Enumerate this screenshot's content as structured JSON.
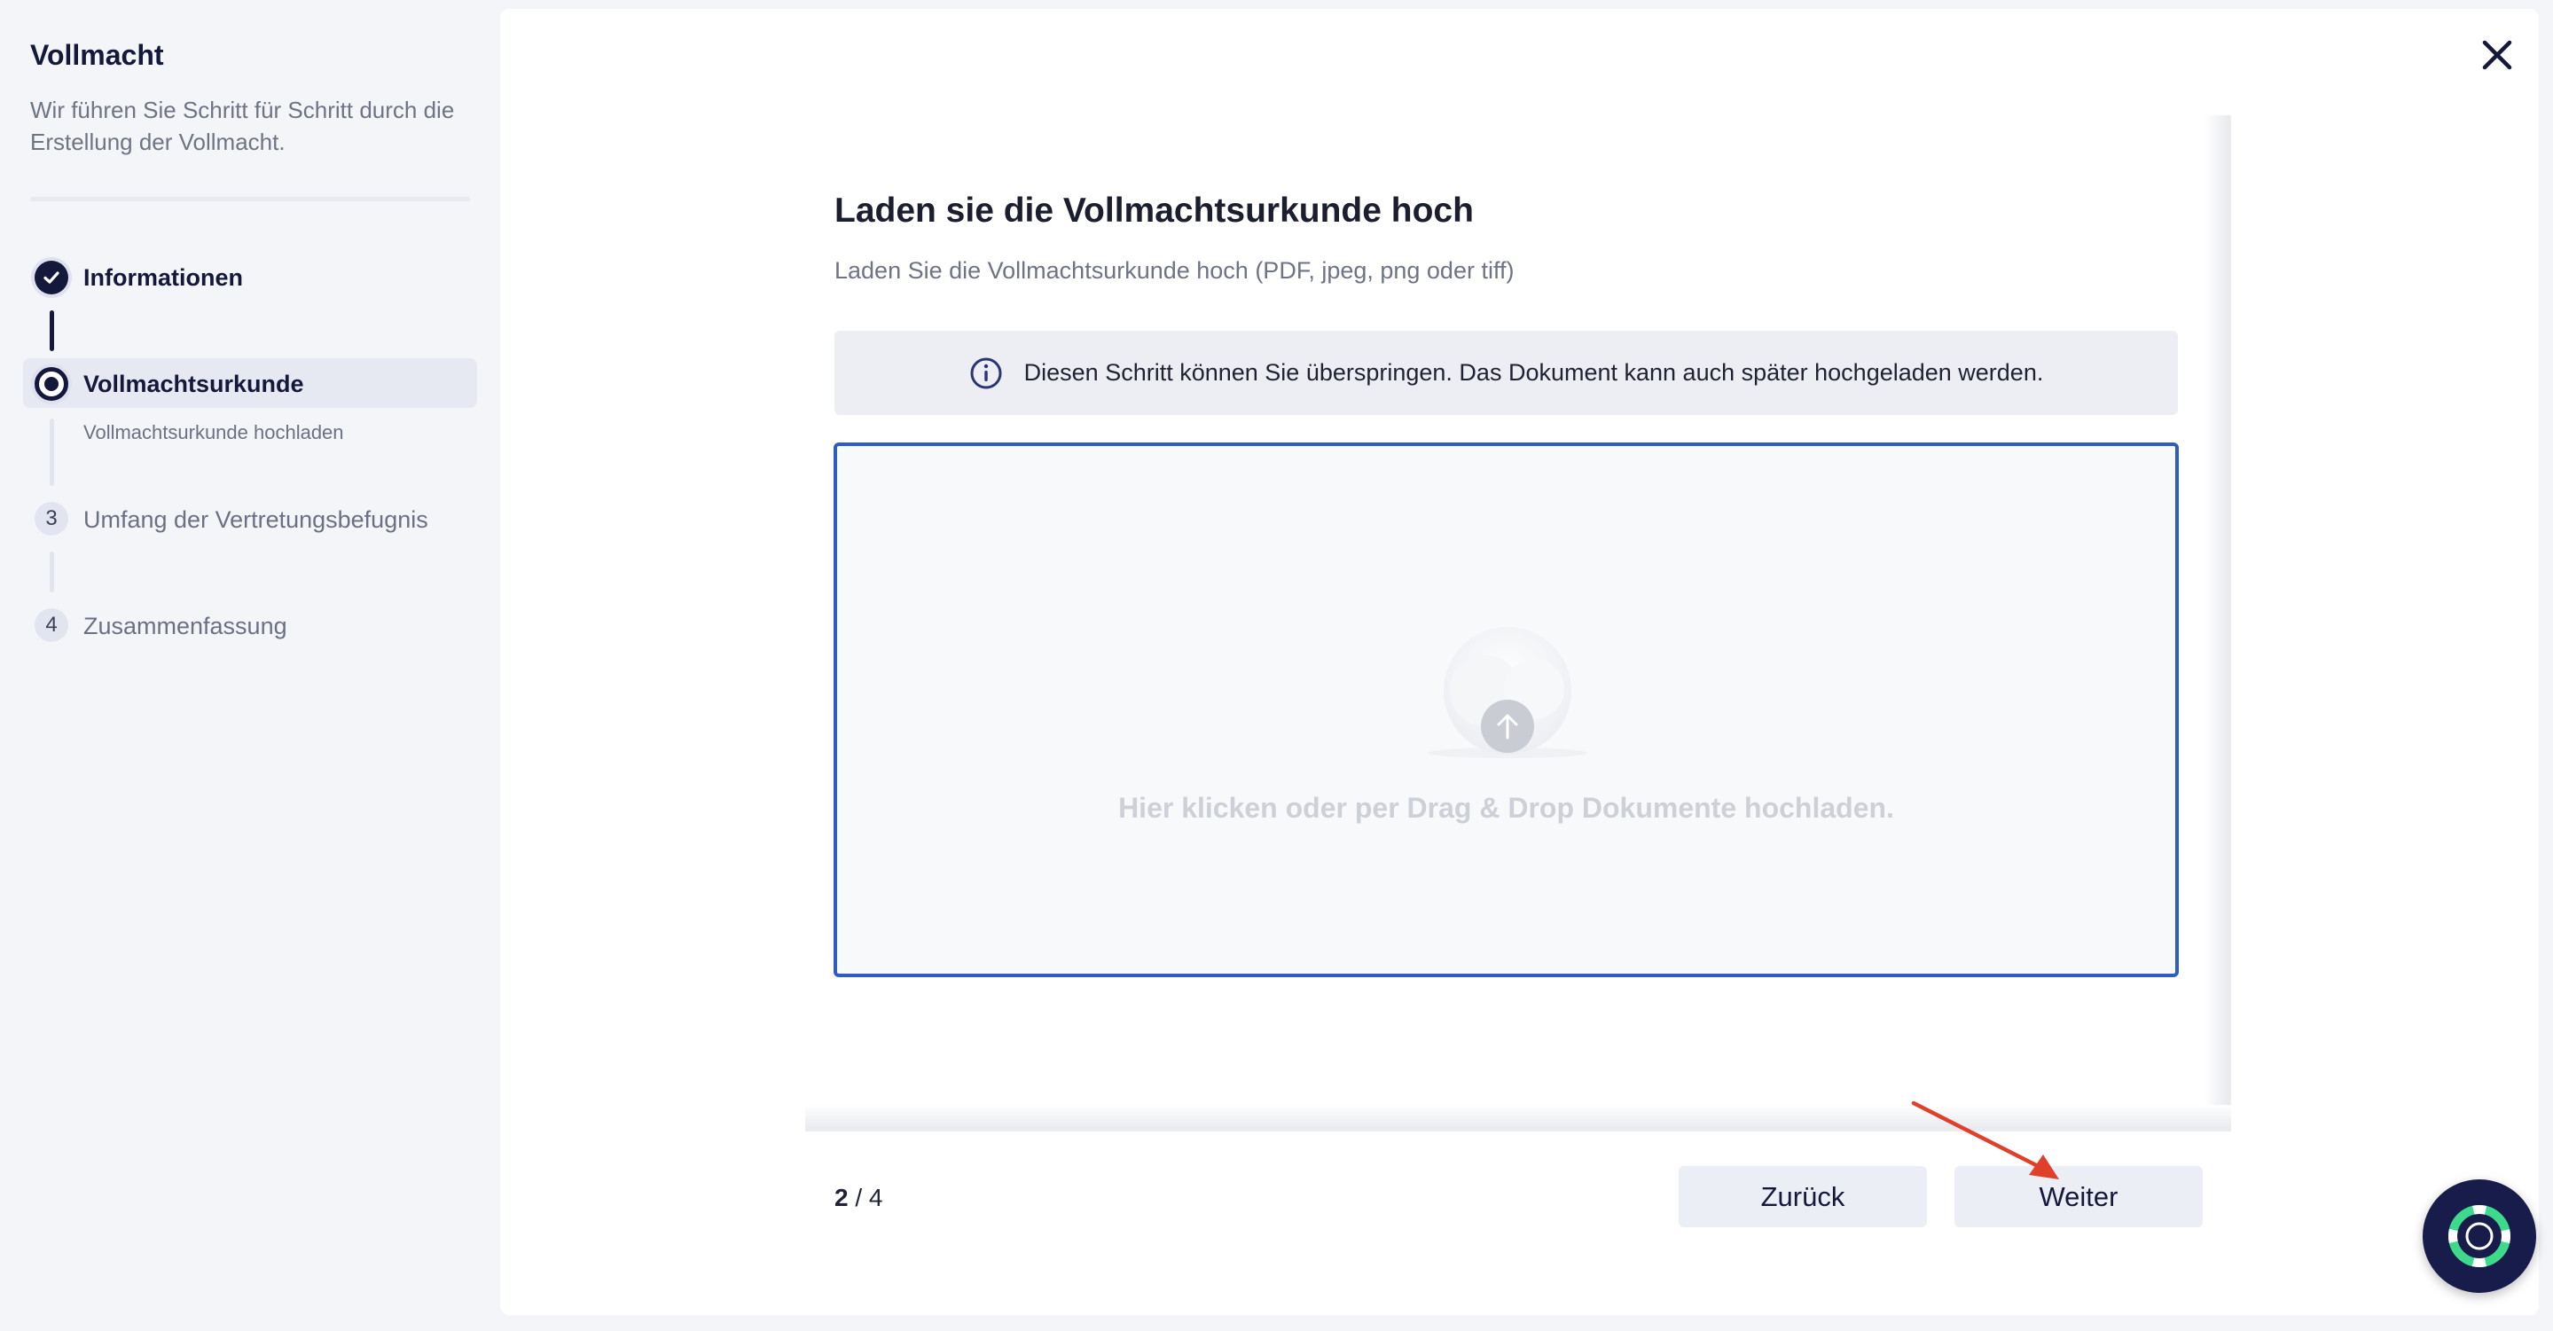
{
  "sidebar": {
    "title": "Vollmacht",
    "subtitle": "Wir führen Sie Schritt für Schritt durch die Erstellung der Vollmacht.",
    "steps": [
      {
        "label": "Informationen",
        "state": "done"
      },
      {
        "label": "Vollmachtsurkunde",
        "state": "current",
        "sub": "Vollmachtsurkunde hochladen"
      },
      {
        "number": "3",
        "label": "Umfang der Vertretungsbefugnis",
        "state": "todo"
      },
      {
        "number": "4",
        "label": "Zusammenfassung",
        "state": "todo"
      }
    ]
  },
  "main": {
    "title": "Laden sie die Vollmachtsurkunde hoch",
    "subtitle": "Laden Sie die Vollmachtsurkunde hoch (PDF, jpeg, png oder tiff)",
    "info": "Diesen Schritt können Sie überspringen. Das Dokument kann auch später hochgeladen werden.",
    "dropzone_text": "Hier klicken oder per Drag & Drop Dokumente hochladen."
  },
  "footer": {
    "page_current": "2",
    "page_total": "4",
    "back_label": "Zurück",
    "next_label": "Weiter"
  },
  "colors": {
    "primary": "#14183a",
    "dropzone_border": "#2d5cc4",
    "annotation_arrow": "#e0402a",
    "help_accent": "#3fd98c"
  },
  "icons": {
    "close": "close-icon",
    "info": "info-icon",
    "upload": "cloud-upload-icon",
    "help": "lifebuoy-icon"
  }
}
